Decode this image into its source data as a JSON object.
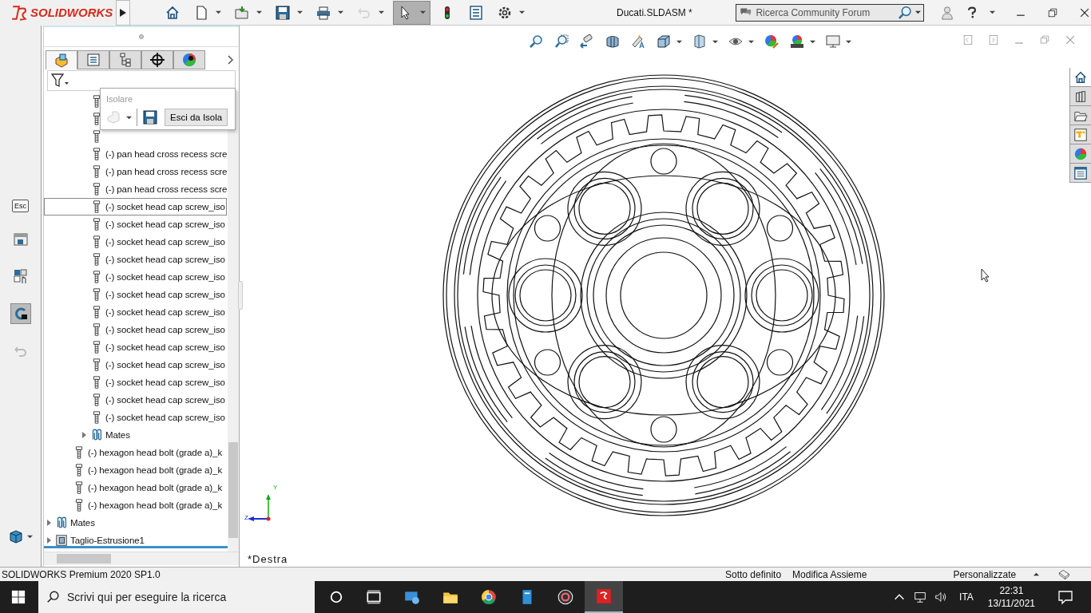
{
  "app": {
    "logo": "SOLIDWORKS"
  },
  "toolbar": [
    {
      "kind": "home",
      "dropdown": false,
      "disabled": false,
      "selected": false
    },
    {
      "kind": "new",
      "dropdown": true,
      "disabled": false,
      "selected": false
    },
    {
      "kind": "open",
      "dropdown": true,
      "disabled": false,
      "selected": false
    },
    {
      "kind": "save",
      "dropdown": true,
      "disabled": false,
      "selected": false
    },
    {
      "kind": "print",
      "dropdown": true,
      "disabled": false,
      "selected": false
    },
    {
      "kind": "undo",
      "dropdown": true,
      "disabled": true,
      "selected": false
    },
    {
      "kind": "select",
      "dropdown": true,
      "disabled": false,
      "selected": true
    },
    {
      "kind": "rebuild",
      "dropdown": false,
      "disabled": false,
      "selected": false
    },
    {
      "kind": "file-properties",
      "dropdown": false,
      "disabled": false,
      "selected": false
    },
    {
      "kind": "options",
      "dropdown": true,
      "disabled": false,
      "selected": false
    }
  ],
  "window": {
    "title": "Ducati.SLDASM *"
  },
  "search": {
    "placeholder": "Ricerca Community Forum"
  },
  "command_column": [
    {
      "kind": "key",
      "label": "Esc"
    },
    {
      "kind": "window"
    },
    {
      "kind": "select-component"
    },
    {
      "kind": "lock",
      "selected": true
    },
    {
      "kind": "undo"
    }
  ],
  "feature_manager": {
    "tabs": [
      {
        "kind": "feature-tree",
        "selected": true
      },
      {
        "kind": "property",
        "selected": false
      },
      {
        "kind": "configuration",
        "selected": false
      },
      {
        "kind": "dimxpert",
        "selected": false
      },
      {
        "kind": "display",
        "selected": false
      }
    ],
    "tree": [
      {
        "children": [
          {
            "children": [
              {
                "kind": "part",
                "selected": false
              },
              {
                "kind": "part",
                "selected": false
              },
              {
                "kind": "part",
                "selected": false
              },
              {
                "kind": "part",
                "label": "(-) pan head cross recess scre",
                "selected": false
              },
              {
                "kind": "part",
                "label": "(-) pan head cross recess scre",
                "selected": false
              },
              {
                "kind": "part",
                "label": "(-) pan head cross recess scre",
                "selected": false
              },
              {
                "kind": "part",
                "label": "(-) socket head cap screw_iso",
                "selected": true
              },
              {
                "kind": "part",
                "label": "(-) socket head cap screw_iso",
                "selected": false
              },
              {
                "kind": "part",
                "label": "(-) socket head cap screw_iso",
                "selected": false
              },
              {
                "kind": "part",
                "label": "(-) socket head cap screw_iso",
                "selected": false
              },
              {
                "kind": "part",
                "label": "(-) socket head cap screw_iso",
                "selected": false
              },
              {
                "kind": "part",
                "label": "(-) socket head cap screw_iso",
                "selected": false
              },
              {
                "kind": "part",
                "label": "(-) socket head cap screw_iso",
                "selected": false
              },
              {
                "kind": "part",
                "label": "(-) socket head cap screw_iso",
                "selected": false
              },
              {
                "kind": "part",
                "label": "(-) socket head cap screw_iso",
                "selected": false
              },
              {
                "kind": "part",
                "label": "(-) socket head cap screw_iso",
                "selected": false
              },
              {
                "kind": "part",
                "label": "(-) socket head cap screw_iso",
                "selected": false
              },
              {
                "kind": "part",
                "label": "(-) socket head cap screw_iso",
                "selected": false
              },
              {
                "kind": "part",
                "label": "(-) socket head cap screw_iso",
                "selected": false
              },
              {
                "kind": "mates",
                "label": "Mates",
                "expanded": false,
                "selected": false
              }
            ]
          },
          {
            "kind": "part",
            "label": "(-) hexagon head bolt (grade a)_k",
            "selected": false
          },
          {
            "kind": "part",
            "label": "(-) hexagon head bolt (grade a)_k",
            "selected": false
          },
          {
            "kind": "part",
            "label": "(-) hexagon head bolt (grade a)_k",
            "selected": false
          },
          {
            "kind": "part",
            "label": "(-) hexagon head bolt (grade a)_k",
            "selected": false
          }
        ]
      },
      {
        "kind": "mates",
        "label": "Mates",
        "expanded": false,
        "selected": false
      },
      {
        "kind": "feature",
        "label": "Taglio-Estrusione1",
        "expanded": false,
        "selected": false
      }
    ]
  },
  "isolate_popup": {
    "title": "Isolare",
    "button": "Esci da Isola"
  },
  "heads_up_toolbar": [
    {
      "kind": "zoom-fit",
      "dropdown": false
    },
    {
      "kind": "zoom-area",
      "dropdown": false
    },
    {
      "kind": "previous-view",
      "dropdown": false
    },
    {
      "kind": "section-view",
      "dropdown": false
    },
    {
      "kind": "annotation-view",
      "dropdown": false
    },
    {
      "kind": "view-orientation",
      "dropdown": true
    },
    {
      "kind": "display-style",
      "dropdown": true
    },
    {
      "kind": "hide-show",
      "dropdown": true
    },
    {
      "kind": "edit-appearance",
      "dropdown": false
    },
    {
      "kind": "scene",
      "dropdown": true
    },
    {
      "kind": "view-settings",
      "dropdown": true
    }
  ],
  "task_pane": [
    {
      "kind": "home",
      "selected": true
    },
    {
      "kind": "library",
      "selected": false
    },
    {
      "kind": "explorer",
      "selected": false
    },
    {
      "kind": "palette",
      "selected": false
    },
    {
      "kind": "appearance",
      "selected": false
    },
    {
      "kind": "properties",
      "selected": false
    }
  ],
  "triad": {
    "y": "Y",
    "z": "Z"
  },
  "view_label": "*Destra",
  "status_bar": {
    "product": "SOLIDWORKS Premium 2020 SP1.0",
    "items": [
      "Sotto definito",
      "Modifica Assieme"
    ],
    "units": "Personalizzate"
  },
  "taskbar": {
    "search_placeholder": "Scrivi qui per eseguire la ricerca",
    "apps": [
      {
        "kind": "task-view"
      },
      {
        "kind": "network-app"
      },
      {
        "kind": "folder"
      },
      {
        "kind": "browser"
      },
      {
        "kind": "document"
      },
      {
        "kind": "media"
      },
      {
        "kind": "cad",
        "selected": true
      }
    ],
    "language": "ITA",
    "time": "22:31",
    "date": "13/11/2021"
  }
}
